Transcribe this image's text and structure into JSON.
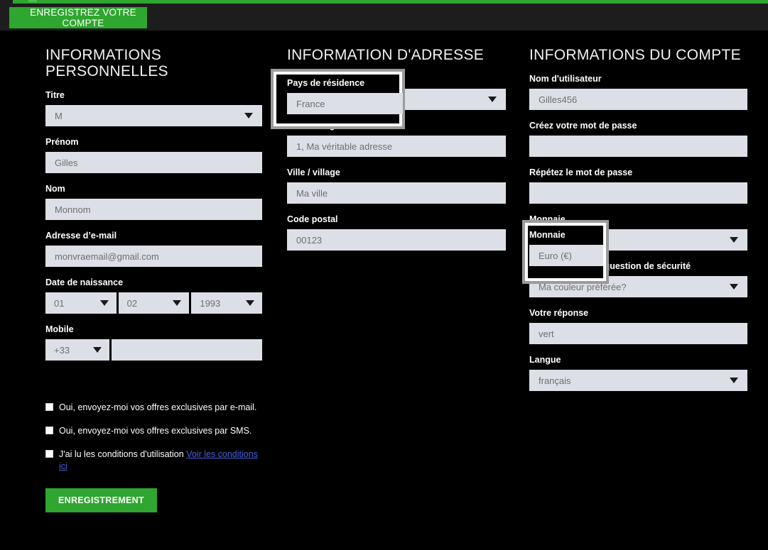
{
  "header": {
    "cta_label": "ENREGISTREZ VOTRE COMPTE"
  },
  "colors": {
    "brand_green": "#2fa62f",
    "page_background": "#000000",
    "input_background": "#dce0e6",
    "input_text": "#6e6e6e",
    "label_text": "#ffffff",
    "link": "#4a5fd8",
    "highlight_outer": "#9b9b9b",
    "highlight_inner": "#ffffff"
  },
  "personal": {
    "title": "INFORMATIONS PERSONNELLES",
    "fields": {
      "titre": {
        "label": "Titre",
        "value": "M",
        "type": "select"
      },
      "prenom": {
        "label": "Prénom",
        "value": "Gilles",
        "type": "text"
      },
      "nom": {
        "label": "Nom",
        "value": "Monnom",
        "type": "text"
      },
      "email": {
        "label": "Adresse d’e-mail",
        "value": "monvraemail@gmail.com",
        "type": "text"
      },
      "naissance": {
        "label": "Date de naissance",
        "day": "01",
        "month": "02",
        "year": "1993"
      },
      "mobile": {
        "label": "Mobile",
        "country_code": "+33",
        "number": ""
      }
    }
  },
  "address": {
    "title": "INFORMATION D'ADRESSE",
    "fields": {
      "pays": {
        "label": "Pays de résidence",
        "value": "France",
        "type": "select"
      },
      "ligne1": {
        "label": "Adresse ligne 1",
        "value": "1, Ma véritable adresse",
        "type": "text"
      },
      "ville": {
        "label": "Ville / village",
        "value": "Ma ville",
        "type": "text"
      },
      "code_postal": {
        "label": "Code postal",
        "value": "00123",
        "type": "text"
      }
    }
  },
  "account": {
    "title": "INFORMATIONS DU COMPTE",
    "fields": {
      "username": {
        "label": "Nom d'utilisateur",
        "value": "Gilles456",
        "type": "text"
      },
      "password": {
        "label": "Créez votre mot de passe",
        "value": "",
        "type": "password"
      },
      "password_repeat": {
        "label": "Répétez le mot de passe",
        "value": "",
        "type": "password"
      },
      "monnaie": {
        "label": "Monnaie",
        "value": "Euro (€)",
        "type": "select"
      },
      "question": {
        "label": "Sélectionnez une question de sécurité",
        "value": "Ma couleur préférée?",
        "type": "select"
      },
      "reponse": {
        "label": "Votre réponse",
        "value": "vert",
        "type": "text"
      },
      "langue": {
        "label": "Langue",
        "value": "français",
        "type": "select"
      }
    }
  },
  "consents": {
    "email_offers": "Oui, envoyez-moi vos offres exclusives par e-mail.",
    "sms_offers": "Oui, envoyez-moi vos offres exclusives par SMS.",
    "terms_prefix": "J'ai lu les conditions d'utilisation ",
    "terms_link": "Voir les conditions ici",
    "submit_label": "ENREGISTREMENT"
  }
}
